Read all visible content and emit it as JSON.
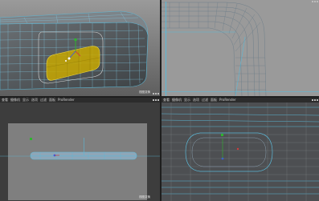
{
  "menu": {
    "view": "查看",
    "camera": "摄像机",
    "display": "显示",
    "options": "选项",
    "filter": "过滤",
    "panel": "面板",
    "prorender": "ProRender"
  },
  "viewports": {
    "perspective": {
      "camera": "视图变换"
    },
    "top": {
      "camera": ""
    },
    "front": {
      "camera": "视图变换"
    },
    "right": {
      "camera": "视图变换"
    }
  },
  "colors": {
    "background_dark": "#3a3a3a",
    "viewport_gray": "#7f7f7f",
    "grid_blue": "#5bb8d6",
    "selection_yellow": "#c8a800",
    "axis_y": "#2fb52f",
    "axis_x": "#d23c3c",
    "axis_z": "#3c5adc"
  }
}
